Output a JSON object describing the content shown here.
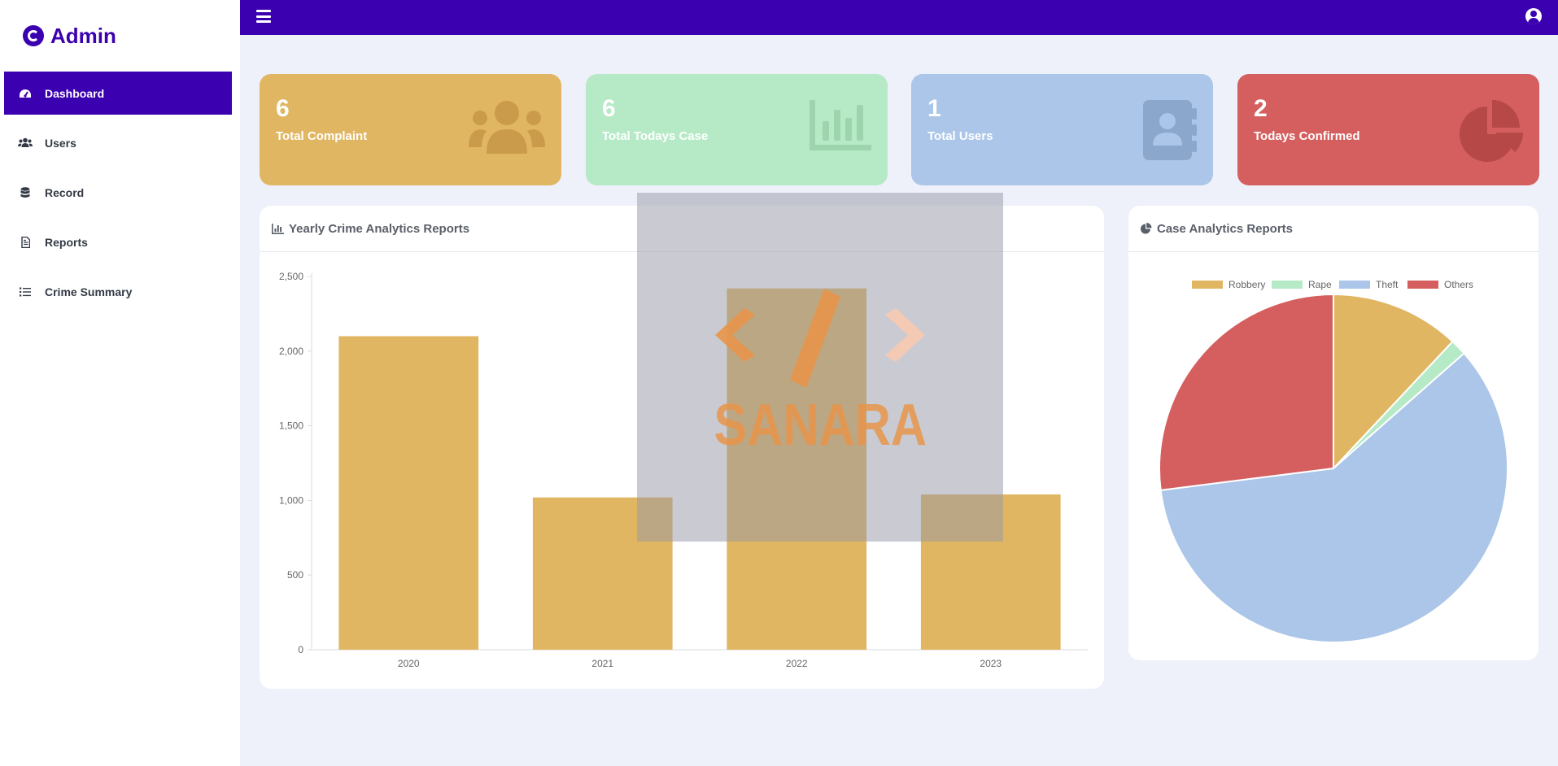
{
  "sidebar": {
    "brand": "Admin",
    "items": [
      {
        "label": "Dashboard",
        "icon": "tachometer-icon",
        "active": true
      },
      {
        "label": "Users",
        "icon": "users-icon"
      },
      {
        "label": "Record",
        "icon": "database-icon"
      },
      {
        "label": "Reports",
        "icon": "file-icon"
      },
      {
        "label": "Crime Summary",
        "icon": "list-icon"
      }
    ]
  },
  "stats": [
    {
      "value": "6",
      "label": "Total Complaint",
      "color": "#e1b662",
      "icon": "users-icon"
    },
    {
      "value": "6",
      "label": "Total Todays Case",
      "color": "#b6eac6",
      "icon": "bar-chart-icon"
    },
    {
      "value": "1",
      "label": "Total Users",
      "color": "#abc6e8",
      "icon": "contact-card-icon"
    },
    {
      "value": "2",
      "label": "Todays Confirmed",
      "color": "#d55f5f",
      "icon": "pie-chart-icon"
    }
  ],
  "bar_panel": {
    "title": "Yearly Crime Analytics Reports"
  },
  "pie_panel": {
    "title": "Case Analytics Reports"
  },
  "watermark": {
    "text": "SANARA"
  },
  "chart_data": [
    {
      "type": "bar",
      "categories": [
        "2020",
        "2021",
        "2022",
        "2023"
      ],
      "values": [
        2100,
        1020,
        2420,
        1040
      ],
      "ylim": [
        0,
        2500
      ],
      "yticks": [
        0,
        500,
        1000,
        1500,
        2000,
        2500
      ],
      "ytick_labels": [
        "0",
        "500",
        "1,000",
        "1,500",
        "2,000",
        "2,500"
      ],
      "color": "#e1b662",
      "grid": false
    },
    {
      "type": "pie",
      "labels": [
        "Robbery",
        "Rape",
        "Theft",
        "Others"
      ],
      "values": [
        12,
        1.5,
        59.5,
        27
      ],
      "colors": [
        "#e1b662",
        "#b6eac6",
        "#abc6e8",
        "#d55f5f"
      ],
      "legend": "top"
    }
  ]
}
